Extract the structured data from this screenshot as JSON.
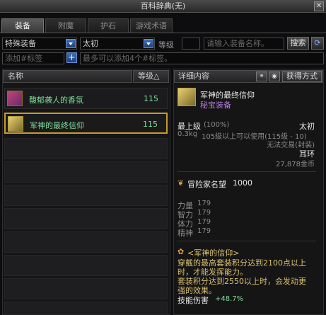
{
  "window": {
    "title": "百科辞典(无)"
  },
  "tabs": [
    {
      "label": "装备"
    },
    {
      "label": "附魔"
    },
    {
      "label": "护石"
    },
    {
      "label": "游戏术语"
    }
  ],
  "filters": {
    "type": "特殊装备",
    "source": "太初",
    "level_label": "等级",
    "level_value": "",
    "search_placeholder": "请输入装备名称。",
    "search_button": "搜索",
    "tag_placeholder": "添加#标签",
    "tag_hint": "最多可以添加4个#标签。"
  },
  "list": {
    "col_name": "名称",
    "col_level": "等级△",
    "items": [
      {
        "name": "馥郁袭人的香氛",
        "level": "115"
      },
      {
        "name": "军神的最终信仰",
        "level": "115"
      }
    ]
  },
  "detail": {
    "header": "详细内容",
    "acquire_button": "获得方式",
    "item_name": "军神的最终信仰",
    "item_grade": "秘宝装备",
    "level_label": "最上级",
    "level_pct": "(100%)",
    "origin": "太初",
    "weight": "0.3kg",
    "use_req": "105级以上可以使用(115级 - 10)",
    "trade": "无法交易(封装)",
    "slot": "耳环",
    "price": "27,878金币",
    "renown_label": "冒险家名望",
    "renown_value": "1000",
    "stats": [
      {
        "name": "力量",
        "value": "179"
      },
      {
        "name": "智力",
        "value": "179"
      },
      {
        "name": "体力",
        "value": "179"
      },
      {
        "name": "精神",
        "value": "179"
      }
    ],
    "set_title": "<军神的信仰>",
    "set_line1": "穿戴的最高套装积分达到2100点以上",
    "set_line2": "时，才能发挥能力。",
    "set_line3": "套装积分达到2550以上时，会发动更",
    "set_line4": "强的效果。",
    "skill_label": "技能伤害",
    "skill_value": "+48.7%"
  }
}
